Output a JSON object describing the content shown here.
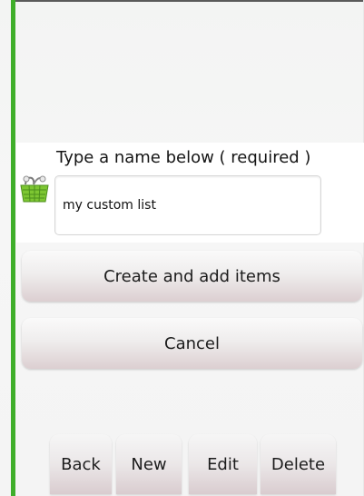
{
  "form": {
    "prompt": "Type a name below ( required )",
    "name_value": "my custom list",
    "list_icon": "shopping-basket-icon"
  },
  "actions": {
    "create_label": "Create and add items",
    "cancel_label": "Cancel"
  },
  "toolbar": {
    "back_label": "Back",
    "new_label": "New",
    "edit_label": "Edit",
    "delete_label": "Delete"
  },
  "colors": {
    "accent_green": "#3fae2a",
    "button_tint": "#dccfd1"
  }
}
